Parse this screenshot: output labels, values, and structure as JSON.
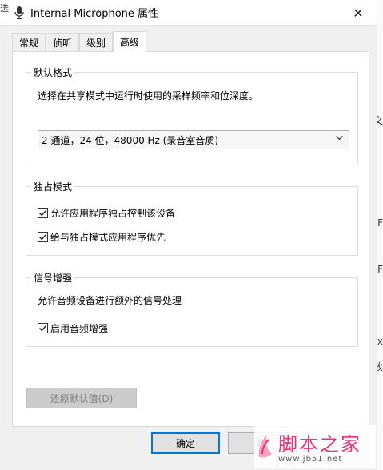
{
  "window": {
    "title": "Internal Microphone 属性",
    "close_glyph": "✕"
  },
  "tabs": [
    {
      "label": "常规"
    },
    {
      "label": "侦听"
    },
    {
      "label": "级别"
    },
    {
      "label": "高级",
      "active": true
    }
  ],
  "default_format": {
    "legend": "默认格式",
    "description": "选择在共享模式中运行时使用的采样频率和位深度。",
    "selected": "2 通道，24 位，48000 Hz (录音室音质)"
  },
  "exclusive_mode": {
    "legend": "独占模式",
    "options": [
      {
        "label": "允许应用程序独占控制该设备",
        "checked": true
      },
      {
        "label": "给与独占模式应用程序优先",
        "checked": true
      }
    ]
  },
  "signal_enhancement": {
    "legend": "信号增强",
    "description": "允许音频设备进行额外的信号处理",
    "option": {
      "label": "启用音频增强",
      "checked": true
    }
  },
  "buttons": {
    "restore_defaults": "还原默认值(D)",
    "ok": "确定",
    "cancel": "取"
  },
  "background_fragments": {
    "top_left": "选",
    "right_1": "文",
    "right_2": "F",
    "right_3": "F",
    "right_4": "x",
    "right_5": "放"
  },
  "watermark": {
    "title": "脚本之家",
    "url": "www.jb51.net"
  },
  "colors": {
    "accent": "#0078d7",
    "watermark": "#e8317a"
  }
}
